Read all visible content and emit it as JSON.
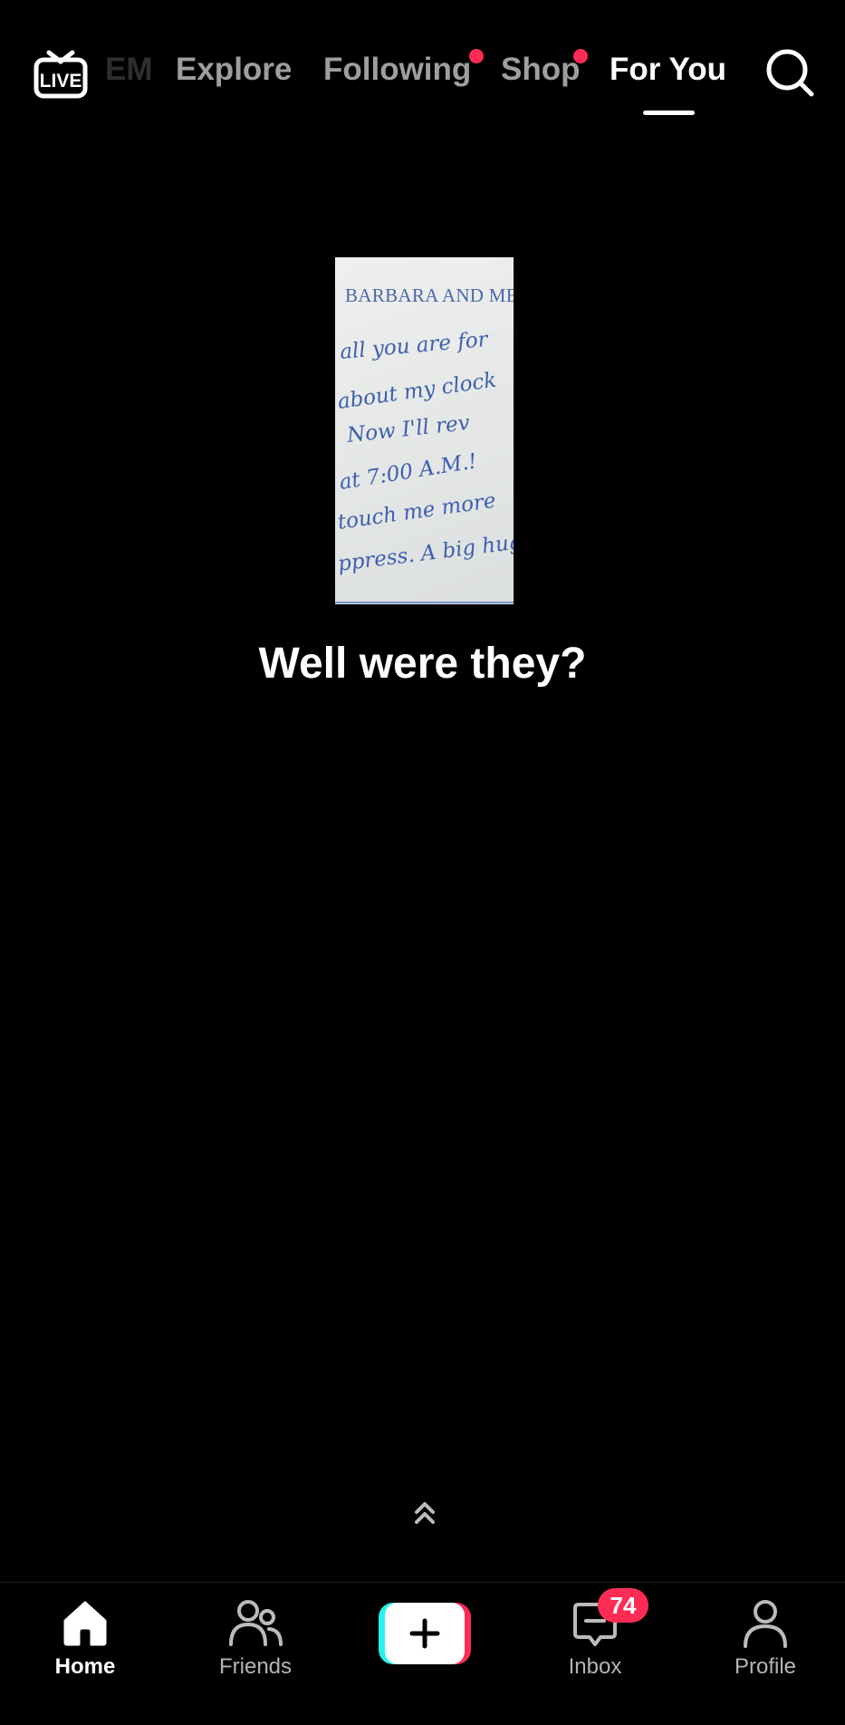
{
  "top_bar": {
    "live_label": "LIVE",
    "tabs": [
      {
        "label": "EM",
        "state": "faded-partial"
      },
      {
        "label": "Explore",
        "state": "inactive"
      },
      {
        "label": "Following",
        "state": "inactive",
        "notification_dot": true
      },
      {
        "label": "Shop",
        "state": "inactive",
        "notification_dot": true
      },
      {
        "label": "For You",
        "state": "active"
      }
    ],
    "search_icon": "search-icon"
  },
  "post": {
    "image_header_text": "BARBARA AND MER",
    "image_handwriting": [
      "all you are for",
      "about my clock",
      "Now I'll rev",
      "at 7:00 A.M.!",
      "touch me more",
      "ppress.   A big hug"
    ],
    "caption": "Well were they?",
    "swipe_hint_icon": "double-chevron-up-icon"
  },
  "bottom_nav": {
    "items": [
      {
        "label": "Home",
        "icon": "home-icon",
        "active": true
      },
      {
        "label": "Friends",
        "icon": "friends-icon",
        "active": false
      },
      {
        "label": "",
        "icon": "plus-icon",
        "active": false
      },
      {
        "label": "Inbox",
        "icon": "inbox-icon",
        "active": false,
        "badge": "74"
      },
      {
        "label": "Profile",
        "icon": "profile-icon",
        "active": false
      }
    ]
  },
  "colors": {
    "background": "#000000",
    "accent_red": "#fe2c55",
    "accent_cyan": "#25f4ee",
    "ink_blue": "#3c5fb0"
  }
}
